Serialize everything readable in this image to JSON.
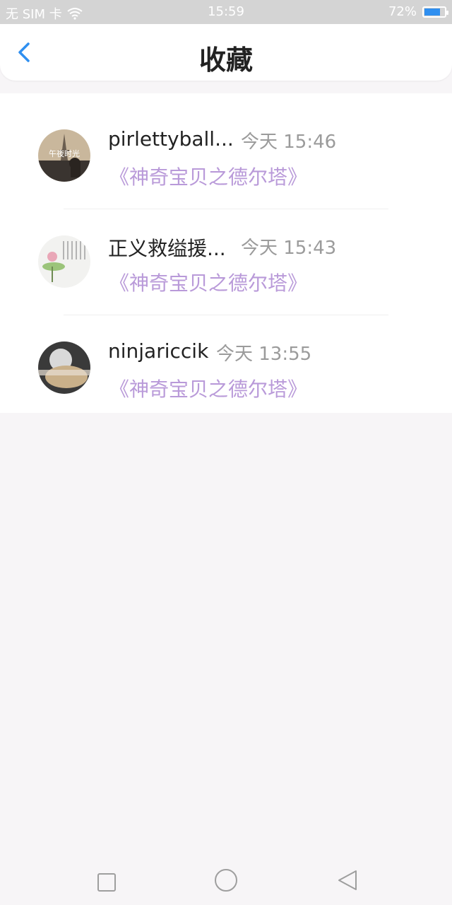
{
  "status_bar": {
    "carrier": "无 SIM 卡",
    "time": "15:59",
    "battery": "72%",
    "battery_level": 0.72
  },
  "header": {
    "title": "收藏",
    "back_icon": "chevron-left-icon",
    "accent_color": "#2f8ff0"
  },
  "favorites": [
    {
      "name": "pirlettyball...",
      "time": "今天 15:46",
      "subtitle": "《神奇宝贝之德尔塔》",
      "avatar_text": "午夜时光"
    },
    {
      "name": "正义救缢援...",
      "time": "今天 15:43",
      "subtitle": "《神奇宝贝之德尔塔》"
    },
    {
      "name": "ninjariccik",
      "time": "今天 13:55",
      "subtitle": "《神奇宝贝之德尔塔》"
    }
  ],
  "colors": {
    "subtitle": "#b99ad9",
    "time": "#9b9b9b",
    "background": "#f7f5f7"
  }
}
